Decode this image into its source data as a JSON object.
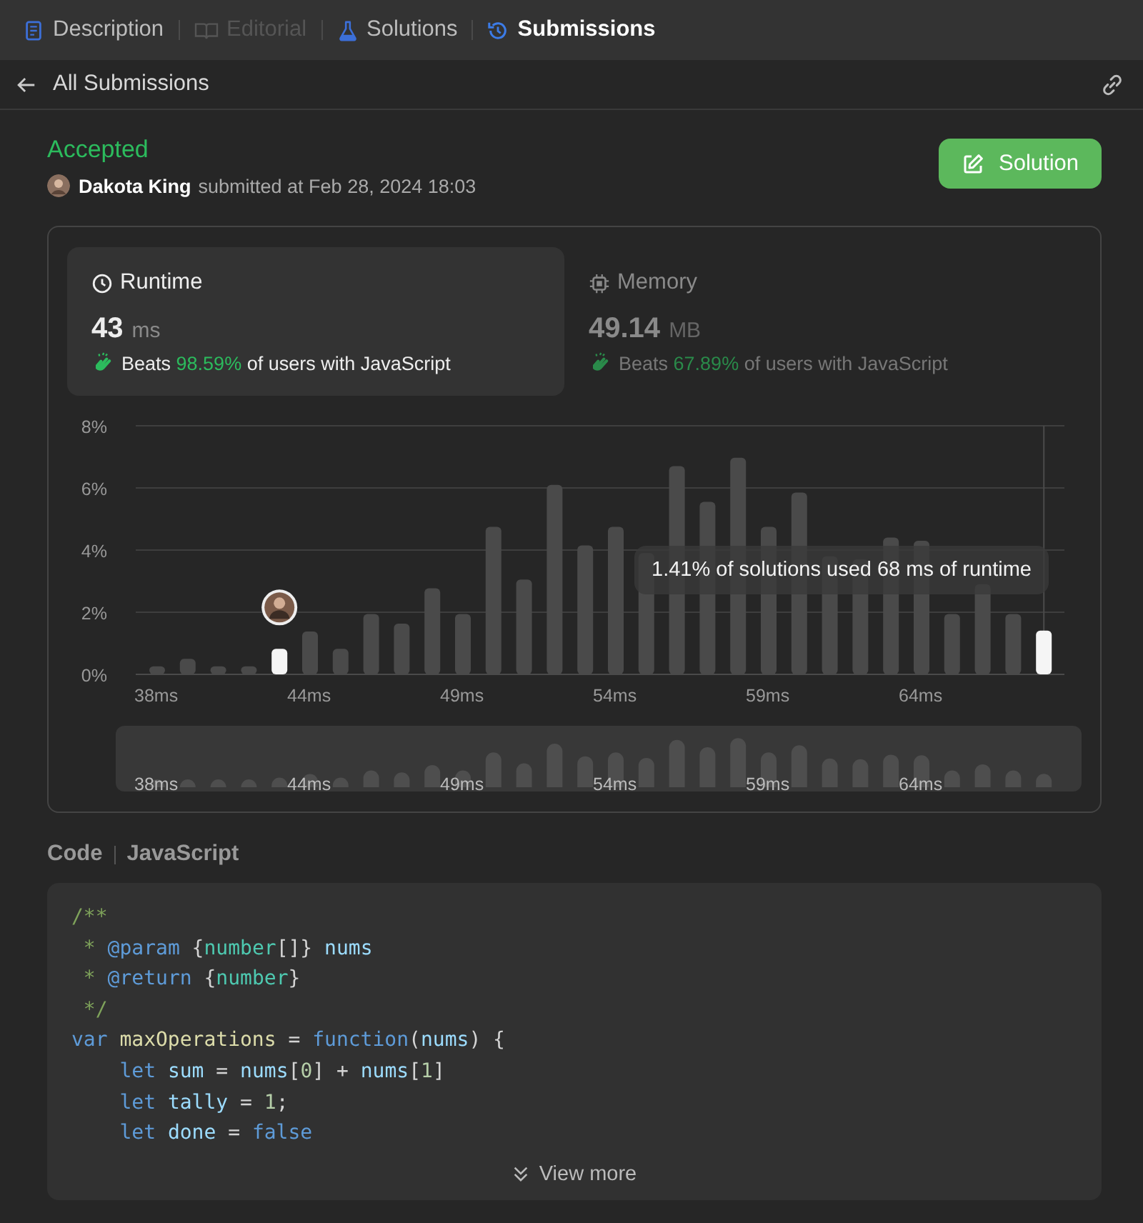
{
  "tabs": [
    {
      "label": "Description",
      "selected": false,
      "disabled": false
    },
    {
      "label": "Editorial",
      "selected": false,
      "disabled": true
    },
    {
      "label": "Solutions",
      "selected": false,
      "disabled": false
    },
    {
      "label": "Submissions",
      "selected": true,
      "disabled": false
    }
  ],
  "header": {
    "back_label": "All Submissions"
  },
  "result": {
    "status": "Accepted",
    "user": "Dakota King",
    "submitted": "submitted at Feb 28, 2024 18:03",
    "solution_button": "Solution"
  },
  "metrics": [
    {
      "kind": "runtime",
      "label": "Runtime",
      "value": "43",
      "unit": "ms",
      "beats": "Beats",
      "percent": "98.59%",
      "suffix": "of users with JavaScript",
      "selected": true
    },
    {
      "kind": "memory",
      "label": "Memory",
      "value": "49.14",
      "unit": "MB",
      "beats": "Beats",
      "percent": "67.89%",
      "suffix": "of users with JavaScript",
      "selected": false
    }
  ],
  "chart": {
    "tooltip": "1.41% of solutions used 68 ms of runtime",
    "chart_data": {
      "type": "bar",
      "grid": true,
      "categories": [
        "38ms",
        null,
        null,
        null,
        null,
        "44ms",
        null,
        null,
        null,
        null,
        "49ms",
        null,
        null,
        null,
        null,
        "54ms",
        null,
        null,
        null,
        null,
        "59ms",
        null,
        null,
        null,
        null,
        "64ms",
        null,
        null,
        null,
        null
      ],
      "series": [
        {
          "color": "#4a4a4a",
          "values": [
            0.26,
            0.5,
            0.26,
            0.26,
            null,
            1.38,
            0.82,
            1.94,
            1.63,
            2.77,
            1.94,
            4.75,
            3.05,
            6.1,
            4.15,
            4.75,
            3.9,
            6.7,
            5.55,
            6.97,
            4.75,
            5.85,
            3.8,
            3.7,
            4.4,
            4.3,
            1.94,
            2.9,
            1.94,
            null
          ]
        },
        {
          "color": "#f5f5f5",
          "values": [
            null,
            null,
            null,
            null,
            0.82,
            null,
            null,
            null,
            null,
            null,
            null,
            null,
            null,
            null,
            null,
            null,
            null,
            null,
            null,
            null,
            null,
            null,
            null,
            null,
            null,
            null,
            null,
            null,
            null,
            1.41
          ]
        }
      ],
      "ylim": [
        0,
        8
      ],
      "yticks": [
        {
          "value": 0,
          "label": "0%"
        },
        {
          "value": 2,
          "label": "2%"
        },
        {
          "value": 4,
          "label": "4%"
        },
        {
          "value": 6,
          "label": "6%"
        },
        {
          "value": 8,
          "label": "8%"
        }
      ]
    }
  },
  "range_selector": {
    "labels": [
      "38ms",
      "44ms",
      "49ms",
      "54ms",
      "59ms",
      "64ms"
    ]
  },
  "code": {
    "label": "Code",
    "language": "JavaScript",
    "view_more": "View more",
    "lines": [
      [
        {
          "text": "/**",
          "kind": "comment"
        }
      ],
      [
        {
          "text": " * ",
          "kind": "comment"
        },
        {
          "text": "@param",
          "kind": "keyword"
        },
        {
          "text": " {",
          "kind": "punct"
        },
        {
          "text": "number",
          "kind": "type"
        },
        {
          "text": "[]} ",
          "kind": "punct"
        },
        {
          "text": "nums",
          "kind": "variable"
        }
      ],
      [
        {
          "text": " * ",
          "kind": "comment"
        },
        {
          "text": "@return",
          "kind": "keyword"
        },
        {
          "text": " {",
          "kind": "punct"
        },
        {
          "text": "number",
          "kind": "type"
        },
        {
          "text": "}",
          "kind": "punct"
        }
      ],
      [
        {
          "text": " */",
          "kind": "comment"
        }
      ],
      [
        {
          "text": "var ",
          "kind": "keyword"
        },
        {
          "text": "maxOperations",
          "kind": "function"
        },
        {
          "text": " = ",
          "kind": "punct"
        },
        {
          "text": "function",
          "kind": "keyword"
        },
        {
          "text": "(",
          "kind": "punct"
        },
        {
          "text": "nums",
          "kind": "variable"
        },
        {
          "text": ") {",
          "kind": "punct"
        }
      ],
      [
        {
          "text": "    let ",
          "kind": "keyword"
        },
        {
          "text": "sum",
          "kind": "variable"
        },
        {
          "text": " = ",
          "kind": "punct"
        },
        {
          "text": "nums",
          "kind": "variable"
        },
        {
          "text": "[",
          "kind": "punct"
        },
        {
          "text": "0",
          "kind": "number"
        },
        {
          "text": "] + ",
          "kind": "punct"
        },
        {
          "text": "nums",
          "kind": "variable"
        },
        {
          "text": "[",
          "kind": "punct"
        },
        {
          "text": "1",
          "kind": "number"
        },
        {
          "text": "]",
          "kind": "punct"
        }
      ],
      [
        {
          "text": "    let ",
          "kind": "keyword"
        },
        {
          "text": "tally",
          "kind": "variable"
        },
        {
          "text": " = ",
          "kind": "punct"
        },
        {
          "text": "1",
          "kind": "number"
        },
        {
          "text": ";",
          "kind": "punct"
        }
      ],
      [
        {
          "text": "    let ",
          "kind": "keyword"
        },
        {
          "text": "done",
          "kind": "variable"
        },
        {
          "text": " = ",
          "kind": "punct"
        },
        {
          "text": "false",
          "kind": "keyword"
        }
      ]
    ]
  }
}
